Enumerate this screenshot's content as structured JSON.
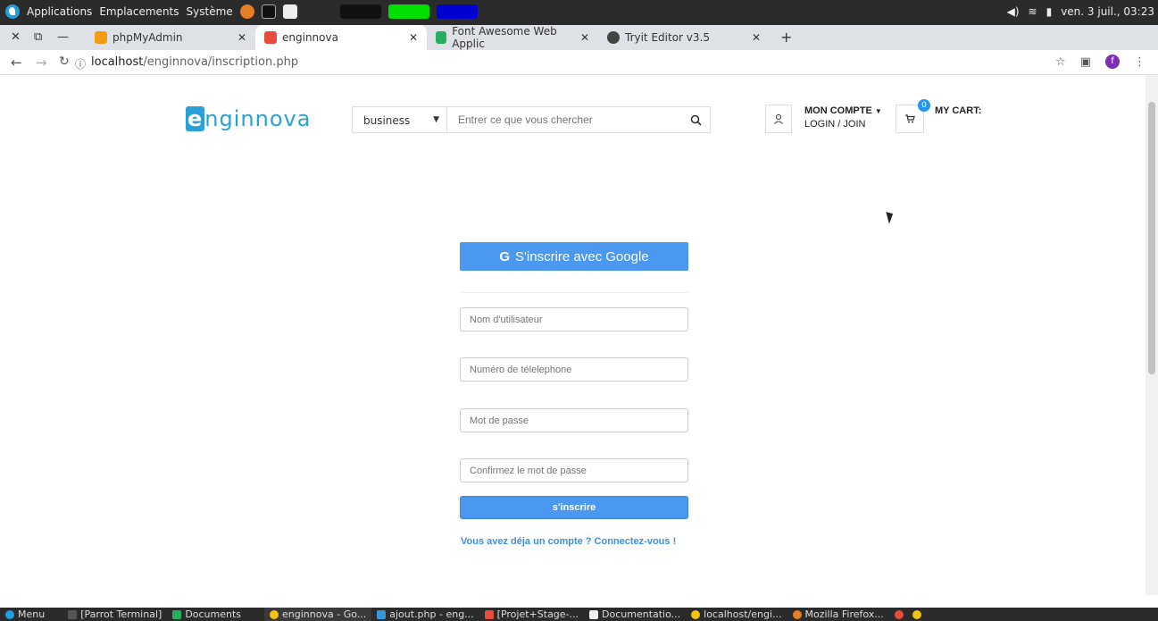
{
  "system_top": {
    "menus": [
      "Applications",
      "Emplacements",
      "Système"
    ],
    "datetime": "ven. 3 juil., 03:23"
  },
  "tabs": [
    {
      "title": "phpMyAdmin",
      "color": "#f39c12"
    },
    {
      "title": "enginnova",
      "color": "#e74c3c"
    },
    {
      "title": "Font Awesome Web Applic",
      "color": "#27ae60"
    },
    {
      "title": "Tryit Editor v3.5",
      "color": "#444444"
    }
  ],
  "address": {
    "host": "localhost",
    "path": "/enginnova/inscription.php"
  },
  "header": {
    "logo_first": "e",
    "logo_rest": "nginnova",
    "category": "business",
    "search_placeholder": "Entrer ce que vous chercher",
    "account_title": "MON COMPTE",
    "account_sub": "LOGIN / JOIN",
    "cart_count": "0",
    "cart_label": "MY CART:",
    "profile_initial": "f"
  },
  "form": {
    "google_letter": "G",
    "google_label": "S'inscrire avec Google",
    "username_placeholder": "Nom d'utilisateur",
    "phone_placeholder": "Numéro de télelephone",
    "password_placeholder": "Mot de passe",
    "confirm_placeholder": "Confirmez le mot de passe",
    "submit_label": "s'inscrire",
    "login_link": "Vous avez déja un compte ? Connectez-vous !"
  },
  "taskbar": [
    {
      "label": "Menu",
      "color": "#1ea0e0"
    },
    {
      "label": "[Parrot Terminal]",
      "color": "#555555"
    },
    {
      "label": "Documents",
      "color": "#27ae60"
    },
    {
      "label": "enginnova - Go...",
      "color": "#f1c40f"
    },
    {
      "label": "ajout.php - eng...",
      "color": "#3498db"
    },
    {
      "label": "[Projet+Stage-...",
      "color": "#e74c3c"
    },
    {
      "label": "Documentatio...",
      "color": "#ecf0f1"
    },
    {
      "label": "localhost/engi...",
      "color": "#f1c40f"
    },
    {
      "label": "Mozilla Firefox...",
      "color": "#e67e22"
    }
  ]
}
